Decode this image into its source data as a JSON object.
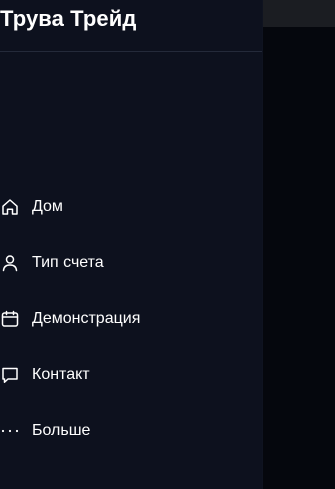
{
  "brand": {
    "title": "Трува Трейд"
  },
  "nav": {
    "items": [
      {
        "id": "home",
        "label": "Дом",
        "icon": "home-icon"
      },
      {
        "id": "account-type",
        "label": "Тип счета",
        "icon": "user-icon"
      },
      {
        "id": "demo",
        "label": "Демонстрация",
        "icon": "calendar-icon"
      },
      {
        "id": "contact",
        "label": "Контакт",
        "icon": "chat-bubble-icon"
      },
      {
        "id": "more",
        "label": "Больше",
        "icon": "ellipsis-icon"
      }
    ]
  },
  "colors": {
    "drawer_background": "#0d111e",
    "backdrop": "#05070d",
    "text": "#ffffff",
    "divider": "#242a3a"
  }
}
